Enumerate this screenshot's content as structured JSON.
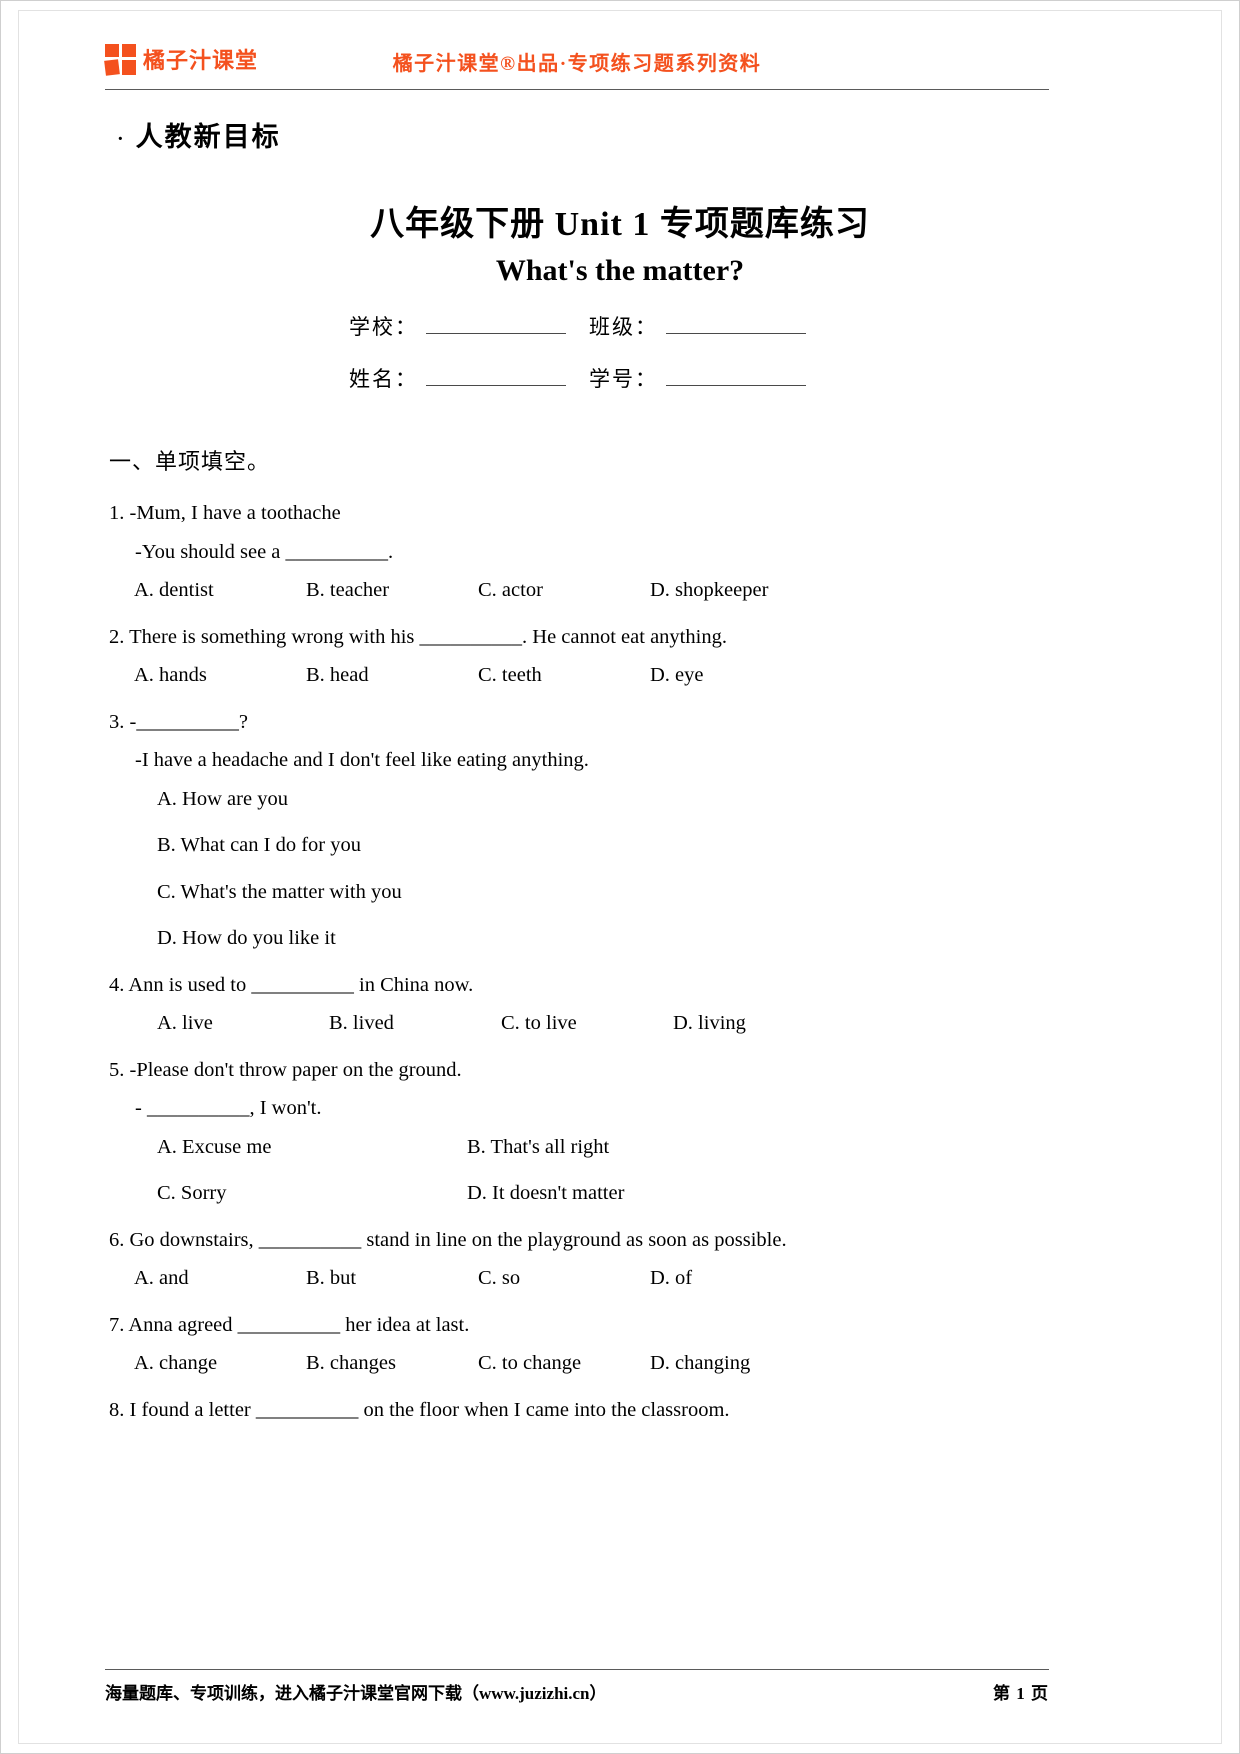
{
  "header": {
    "brand_name": "橘子汁课堂",
    "center_text": "橘子汁课堂®出品·专项练习题系列资料",
    "logo_icon": "orange-juice-squares-logo"
  },
  "series_tag": {
    "bullet": "·",
    "label": "人教新目标"
  },
  "title": {
    "main": "八年级下册 Unit 1  专项题库练习",
    "sub": "What's the matter?"
  },
  "info_fields": [
    {
      "label": "学校：",
      "value": ""
    },
    {
      "label": "班级：",
      "value": ""
    },
    {
      "label": "姓名：",
      "value": ""
    },
    {
      "label": "学号：",
      "value": ""
    }
  ],
  "section": {
    "heading": "一、单项填空。"
  },
  "questions": [
    {
      "stem": "1. -Mum, I have a toothache",
      "sub": "-You should see a __________.",
      "options_inline": [
        "A. dentist",
        "B. teacher",
        "C. actor",
        "D. shopkeeper"
      ]
    },
    {
      "stem": "2. There is something wrong with his __________. He cannot eat anything.",
      "options_inline": [
        "A. hands",
        "B. head",
        "C. teeth",
        "D. eye"
      ]
    },
    {
      "stem": "3. -__________?",
      "sub": "-I have a headache and I don't feel like eating anything.",
      "options_stacked": [
        "A. How are you",
        "B. What can I do for you",
        "C. What's the matter with you",
        "D. How do you like it"
      ]
    },
    {
      "stem": "4. Ann is used to __________ in China now.",
      "options_inline": [
        "A. live",
        "B. lived",
        "C. to live",
        "D. living"
      ]
    },
    {
      "stem": "5. -Please don't throw paper on the ground.",
      "sub": "- __________, I won't.",
      "options_grid": [
        [
          "A. Excuse me",
          "B. That's all right"
        ],
        [
          "C. Sorry",
          "D. It doesn't matter"
        ]
      ]
    },
    {
      "stem": "6. Go downstairs, __________ stand in line on the playground as soon as possible.",
      "options_inline": [
        "A. and",
        "B. but",
        "C. so",
        "D. of"
      ]
    },
    {
      "stem": "7. Anna agreed __________ her idea at last.",
      "options_inline": [
        "A. change",
        "B. changes",
        "C. to change",
        "D. changing"
      ]
    },
    {
      "stem": "8. I found a letter __________ on the floor when I came into the classroom.",
      "options_inline": []
    }
  ],
  "footer": {
    "left": "海量题库、专项训练，进入橘子汁课堂官网下载（www.juzizhi.cn）",
    "right": "第 1 页"
  },
  "colors": {
    "brand": "#f4511e",
    "rule": "#5a5a5a",
    "page_bg": "#ffffff"
  }
}
